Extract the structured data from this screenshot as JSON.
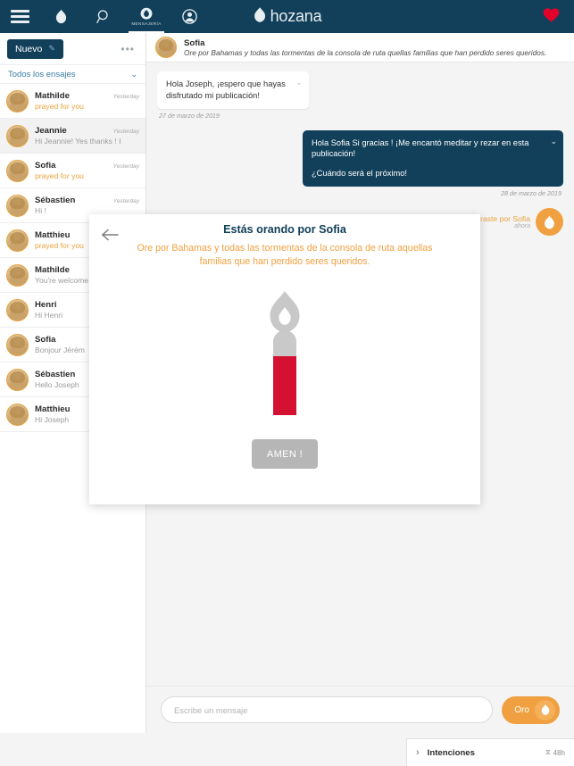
{
  "navbar": {
    "brand": "hozana",
    "menu_icon": "hamburger-icon",
    "items": [
      {
        "name": "flame-icon",
        "label": ""
      },
      {
        "name": "search-icon",
        "label": ""
      },
      {
        "name": "messaging-icon",
        "label": "MENSAJERÍA",
        "active": true
      },
      {
        "name": "account-icon",
        "label": ""
      }
    ],
    "heart_icon": "heart-icon",
    "bg_color": "#12405a",
    "heart_color": "#e4002b"
  },
  "sidebar": {
    "new_button": "Nuevo",
    "more_menu": "•••",
    "filter_label": "Todos los ensajes",
    "conversations": [
      {
        "name": "Mathilde",
        "time": "Yesterday",
        "snippet": "prayed for you",
        "prayed": true,
        "selected": false
      },
      {
        "name": "Jeannie",
        "time": "Yesterday",
        "snippet": "Hi Jeannie! Yes thanks ! I",
        "prayed": false,
        "selected": true
      },
      {
        "name": "Sofia",
        "time": "Yesterday",
        "snippet": "prayed for you",
        "prayed": true,
        "selected": false
      },
      {
        "name": "Sébastien",
        "time": "Yesterday",
        "snippet": "Hi !",
        "prayed": false,
        "selected": false
      },
      {
        "name": "Matthieu",
        "time": "",
        "snippet": "prayed for you",
        "prayed": true,
        "selected": false
      },
      {
        "name": "Mathilde",
        "time": "",
        "snippet": "You're welcome",
        "prayed": false,
        "selected": false
      },
      {
        "name": "Henri",
        "time": "",
        "snippet": "Hi Henri",
        "prayed": false,
        "selected": false
      },
      {
        "name": "Sofia",
        "time": "",
        "snippet": "Bonjour Jérém",
        "prayed": false,
        "selected": false
      },
      {
        "name": "Sébastien",
        "time": "",
        "snippet": "Hello Joseph",
        "prayed": false,
        "selected": false
      },
      {
        "name": "Matthieu",
        "time": "",
        "snippet": "Hi Joseph",
        "prayed": false,
        "selected": false
      }
    ]
  },
  "chat": {
    "header": {
      "name": "Sofia",
      "intention": "Ore por Bahamas y todas las tormentas de la consola de ruta quellas familias que han perdido seres queridos."
    },
    "messages": [
      {
        "direction": "in",
        "line1": "Hola Joseph, ¡espero que hayas",
        "line2": "disfrutado mi publicación!",
        "date": "27 de marzo de 2019"
      },
      {
        "direction": "out",
        "line1": "Hola Sofia Si gracias ! ¡Me encantó meditar y rezar en esta publicación!",
        "line2": "¿Cuándo será el próximo!",
        "date": "28 de marzo de 2019"
      }
    ],
    "prayed_notice": {
      "text": "Oraste por Sofia",
      "time": "ahora",
      "icon": "flame-icon"
    }
  },
  "composer": {
    "placeholder": "Escribe un mensaje",
    "input_value": "",
    "pray_button": "Oro",
    "pray_icon": "flame-icon"
  },
  "intentions_bar": {
    "chevron": "chevron-right-icon",
    "label": "Intenciones",
    "timer_icon": "hourglass-icon",
    "timer_value": "48h"
  },
  "modal": {
    "back_icon": "back-arrow-icon",
    "title": "Estás orando por Sofia",
    "subtitle_line1": "Ore por Bahamas y todas las tormentas de la consola de ruta",
    "subtitle_line2": "aquellas familias que han perdido seres queridos.",
    "candle": {
      "icon": "candle-icon",
      "flame_color": "#c8c8c8",
      "wax_color": "#d41033",
      "top_color": "#c9c9c9"
    },
    "amen_button": "AMEN !",
    "amen_color": "#b6b6b6"
  },
  "colors": {
    "navy": "#12405a",
    "orange": "#f0a040",
    "red": "#e4002b",
    "bg": "#f4f4f4"
  }
}
